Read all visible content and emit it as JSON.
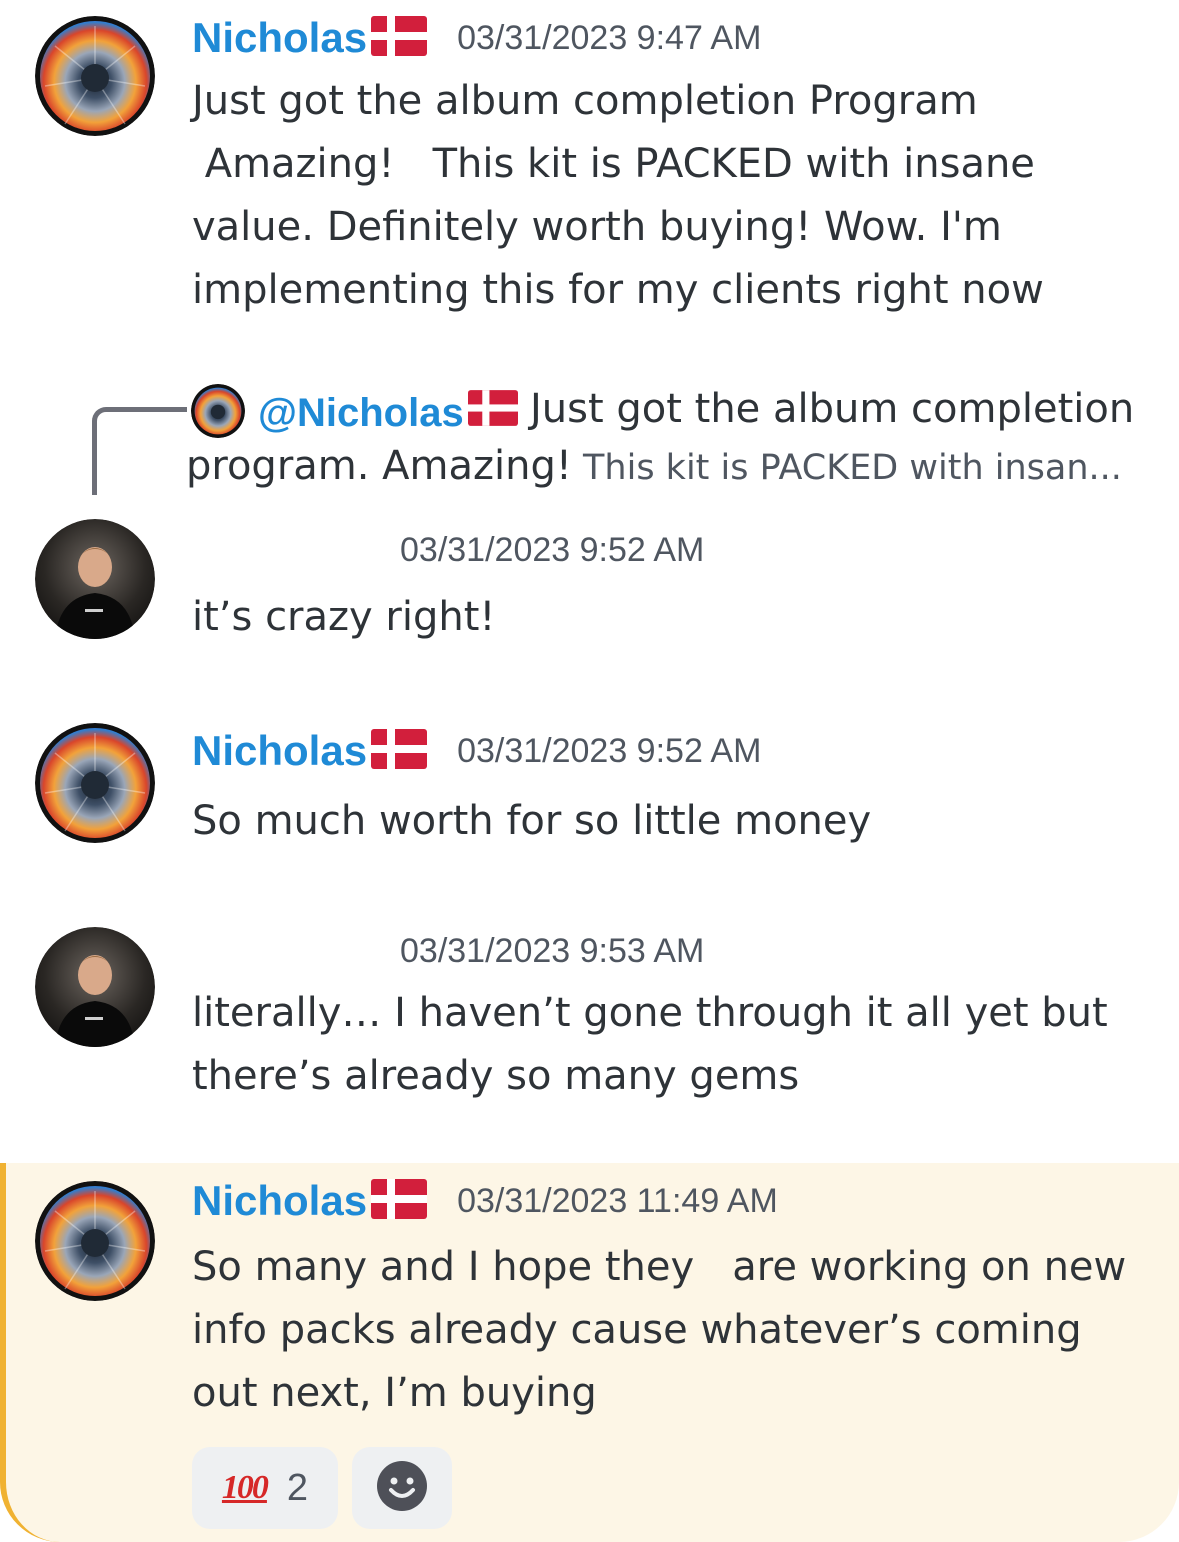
{
  "colors": {
    "username": "#1f8ad6",
    "highlight_bg": "#fdf6e6",
    "highlight_bar": "#f0b232"
  },
  "messages": [
    {
      "username": "Nicholas",
      "flag_icon": "flag-denmark-icon",
      "timestamp": "03/31/2023 9:47 AM",
      "lines": [
        "Just got the album completion Program",
        " Amazing!   This kit is PACKED with insane",
        "value. Definitely worth buying! Wow. I'm",
        "implementing this for my clients right now"
      ]
    },
    {
      "reply": {
        "mention": "@Nicholas",
        "text_line1": "Just got the album completion",
        "text_line2_main": "program. Amazing!",
        "text_line2_rest": " This kit is PACKED with insan..."
      },
      "timestamp": "03/31/2023 9:52 AM",
      "lines": [
        "it’s crazy right!"
      ]
    },
    {
      "username": "Nicholas",
      "flag_icon": "flag-denmark-icon",
      "timestamp": "03/31/2023 9:52 AM",
      "lines": [
        "So much worth for so little money"
      ]
    },
    {
      "timestamp": "03/31/2023 9:53 AM",
      "lines": [
        "literally… I haven’t gone through it all yet but",
        "there’s already so many gems"
      ]
    },
    {
      "username": "Nicholas",
      "flag_icon": "flag-denmark-icon",
      "timestamp": "03/31/2023 11:49 AM",
      "lines": [
        "So many and I hope they   are working on new",
        "info packs already cause whatever’s coming",
        "out next, I’m buying"
      ],
      "reactions": [
        {
          "emoji": "100",
          "emoji_icon": "hundred-points-icon",
          "count": "2"
        },
        {
          "emoji_icon": "add-reaction-icon"
        }
      ]
    }
  ]
}
